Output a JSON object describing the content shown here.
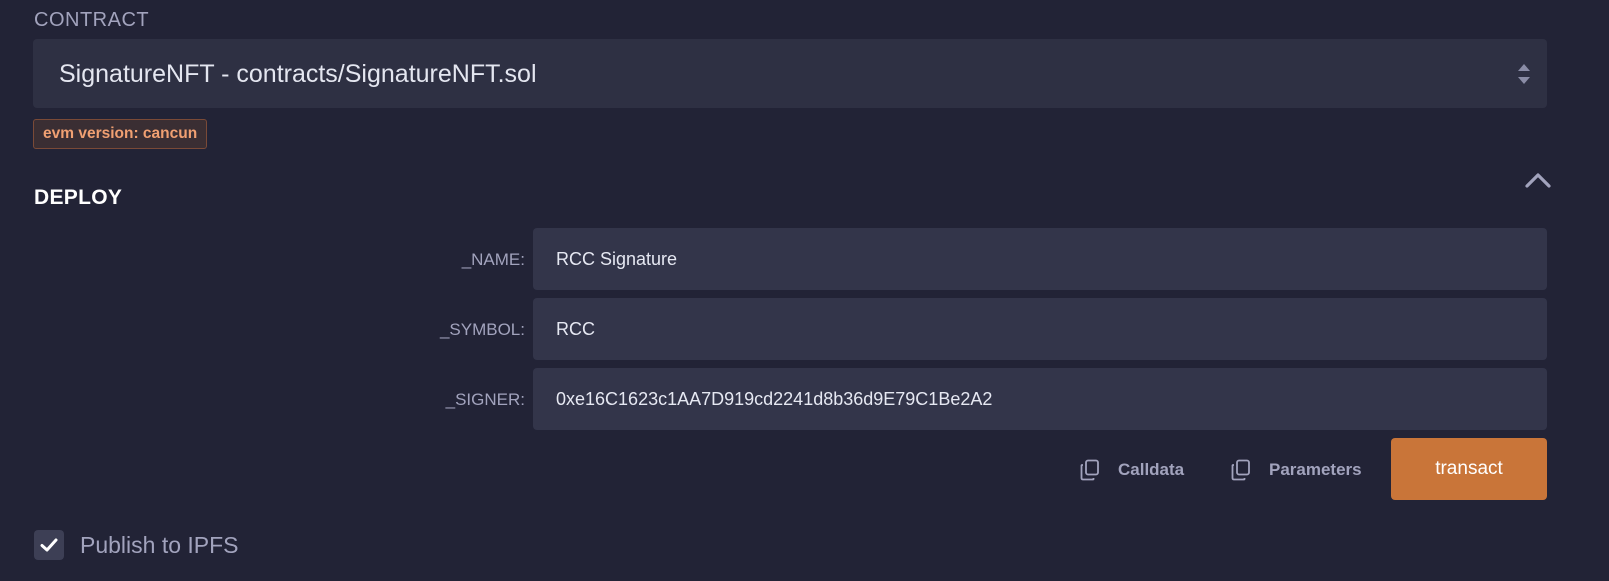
{
  "contract": {
    "section_label": "CONTRACT",
    "selected": "SignatureNFT - contracts/SignatureNFT.sol",
    "evm_badge": "evm version: cancun"
  },
  "deploy": {
    "title": "DEPLOY",
    "params": [
      {
        "label": "_NAME:",
        "value": "RCC Signature"
      },
      {
        "label": "_SYMBOL:",
        "value": "RCC"
      },
      {
        "label": "_SIGNER:",
        "value": "0xe16C1623c1AA7D919cd2241d8b36d9E79C1Be2A2"
      }
    ],
    "calldata_label": "Calldata",
    "parameters_label": "Parameters",
    "transact_label": "transact"
  },
  "publish": {
    "label": "Publish to IPFS",
    "checked": true
  },
  "icons": [
    "select-arrows-icon",
    "chevron-up-icon",
    "copy-icon",
    "check-icon"
  ],
  "colors": {
    "background": "#222336",
    "input_bg": "#33354a",
    "accent": "#c97539",
    "badge_text": "#f0a072"
  }
}
